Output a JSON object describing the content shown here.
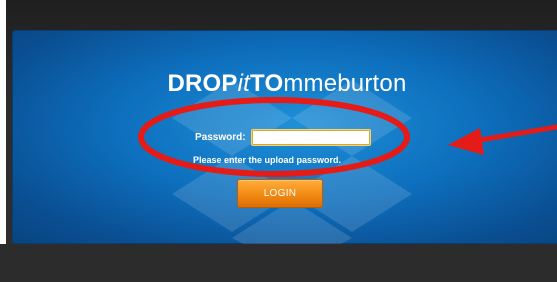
{
  "app": {
    "title_part1": "DROP",
    "title_part2": "it",
    "title_part3": "TO",
    "title_part4": "mmeburton"
  },
  "login": {
    "password_label": "Password:",
    "password_value": "",
    "hint": "Please enter the upload password.",
    "login_button": "LOGIN"
  },
  "colors": {
    "panel_blue": "#0d6fbd",
    "button_orange": "#f28a12",
    "annotation_red": "#e41b17"
  },
  "icons": {
    "background_logo": "dropbox-icon",
    "annotation_arrow": "arrow-left-icon",
    "annotation_circle": "ellipse-highlight-icon"
  }
}
